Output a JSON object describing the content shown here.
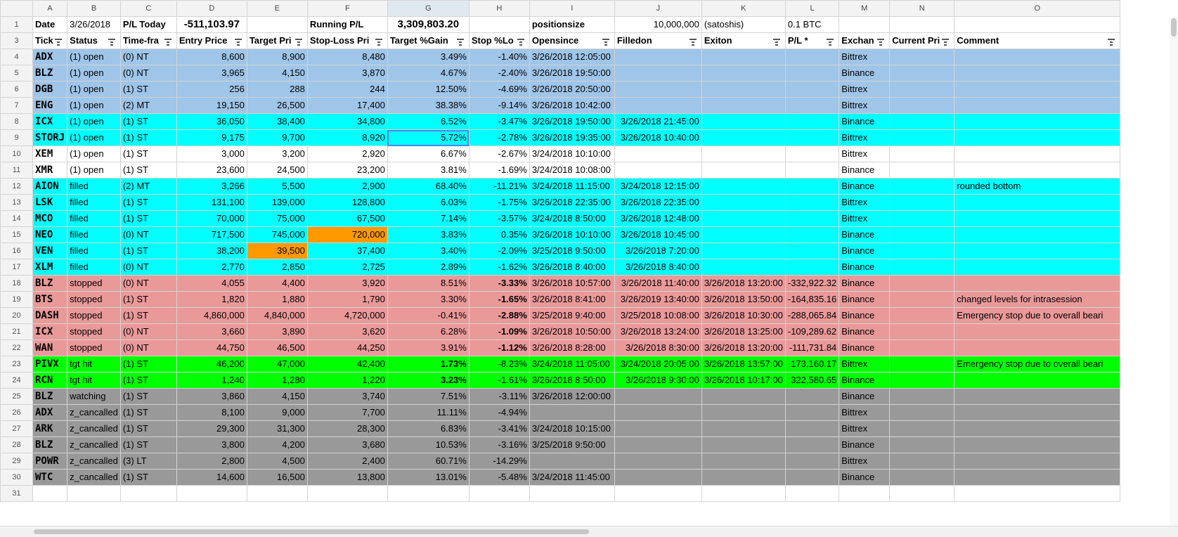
{
  "columns": [
    "A",
    "B",
    "C",
    "D",
    "E",
    "F",
    "G",
    "H",
    "I",
    "J",
    "K",
    "L",
    "M",
    "N",
    "O"
  ],
  "top_row": {
    "row_num": "1",
    "cells": [
      "Date",
      "3/26/2018",
      "P/L Today",
      "-511,103.97",
      "",
      "Running P/L",
      "3,309,803.20",
      "",
      "positionsize",
      "10,000,000",
      "(satoshis)",
      "0.1 BTC",
      "",
      "",
      ""
    ]
  },
  "header_row": {
    "row_num": "3",
    "cells": [
      "Tick",
      "Status",
      "Time-fra",
      "Entry Price",
      "Target Pri",
      "Stop-Loss Pri",
      "Target %Gain",
      "Stop %Lo",
      "Opensince",
      "Filledon",
      "Exiton",
      "P/L *",
      "Exchan",
      "Current Pri",
      "Comment"
    ]
  },
  "rows": [
    {
      "n": "4",
      "style": "blue",
      "c": [
        "ADX",
        "(1) open",
        "(0) NT",
        "8,600",
        "8,900",
        "8,480",
        "3.49%",
        "-1.40%",
        "3/26/2018 12:05:00",
        "",
        "",
        "",
        "Bittrex",
        "",
        ""
      ]
    },
    {
      "n": "5",
      "style": "blue",
      "c": [
        "BLZ",
        "(1) open",
        "(0) NT",
        "3,965",
        "4,150",
        "3,870",
        "4.67%",
        "-2.40%",
        "3/26/2018 19:50:00",
        "",
        "",
        "",
        "Binance",
        "",
        ""
      ]
    },
    {
      "n": "6",
      "style": "blue",
      "c": [
        "DGB",
        "(1) open",
        "(1) ST",
        "256",
        "288",
        "244",
        "12.50%",
        "-4.69%",
        "3/26/2018 20:50:00",
        "",
        "",
        "",
        "Bittrex",
        "",
        ""
      ]
    },
    {
      "n": "7",
      "style": "blue",
      "c": [
        "ENG",
        "(1) open",
        "(2) MT",
        "19,150",
        "26,500",
        "17,400",
        "38.38%",
        "-9.14%",
        "3/26/2018 10:42:00",
        "",
        "",
        "",
        "Bittrex",
        "",
        ""
      ]
    },
    {
      "n": "8",
      "style": "cyan",
      "c": [
        "ICX",
        "(1) open",
        "(1) ST",
        "36,050",
        "38,400",
        "34,800",
        "6.52%",
        "-3.47%",
        "3/26/2018 19:50:00",
        "3/26/2018 21:45:00",
        "",
        "",
        "Binance",
        "",
        ""
      ]
    },
    {
      "n": "9",
      "style": "cyan",
      "c": [
        "STORJ",
        "(1) open",
        "(1) ST",
        "9,175",
        "9,700",
        "8,920",
        "5.72%",
        "-2.78%",
        "3/26/2018 19:35:00",
        "3/26/2018 10:40:00",
        "",
        "",
        "Bittrex",
        "",
        ""
      ]
    },
    {
      "n": "10",
      "style": "white",
      "c": [
        "XEM",
        "(1) open",
        "(1) ST",
        "3,000",
        "3,200",
        "2,920",
        "6.67%",
        "-2.67%",
        "3/24/2018 10:10:00",
        "",
        "",
        "",
        "Bittrex",
        "",
        ""
      ]
    },
    {
      "n": "11",
      "style": "white",
      "c": [
        "XMR",
        "(1) open",
        "(1) ST",
        "23,600",
        "24,500",
        "23,200",
        "3.81%",
        "-1.69%",
        "3/24/2018 10:08:00",
        "",
        "",
        "",
        "Binance",
        "",
        ""
      ]
    },
    {
      "n": "12",
      "style": "cyan",
      "c": [
        "AION",
        "filled",
        "(2) MT",
        "3,266",
        "5,500",
        "2,900",
        "68.40%",
        "-11.21%",
        "3/24/2018 11:15:00",
        "3/24/2018 12:15:00",
        "",
        "",
        "Binance",
        "",
        "rounded bottom"
      ]
    },
    {
      "n": "13",
      "style": "cyan",
      "c": [
        "LSK",
        "filled",
        "(1) ST",
        "131,100",
        "139,000",
        "128,800",
        "6.03%",
        "-1.75%",
        "3/26/2018 22:35:00",
        "3/26/2018 22:35:00",
        "",
        "",
        "Bittrex",
        "",
        ""
      ]
    },
    {
      "n": "14",
      "style": "cyan",
      "c": [
        "MCO",
        "filled",
        "(1) ST",
        "70,000",
        "75,000",
        "67,500",
        "7.14%",
        "-3.57%",
        "3/24/2018 8:50:00",
        "3/26/2018 12:48:00",
        "",
        "",
        "Bittrex",
        "",
        ""
      ]
    },
    {
      "n": "15",
      "style": "cyan",
      "c": [
        "NEO",
        "filled",
        "(0) NT",
        "717,500",
        "745,000",
        "720,000",
        "3.83%",
        "0.35%",
        "3/26/2018 10:10:00",
        "3/26/2018 10:45:00",
        "",
        "",
        "Binance",
        "",
        ""
      ]
    },
    {
      "n": "16",
      "style": "cyan",
      "c": [
        "VEN",
        "filled",
        "(1) ST",
        "38,200",
        "39,500",
        "37,400",
        "3.40%",
        "-2.09%",
        "3/25/2018 9:50:00",
        "3/26/2018 7:20:00",
        "",
        "",
        "Binance",
        "",
        ""
      ]
    },
    {
      "n": "17",
      "style": "cyan",
      "c": [
        "XLM",
        "filled",
        "(0) NT",
        "2,770",
        "2,850",
        "2,725",
        "2.89%",
        "-1.62%",
        "3/26/2018 8:40:00",
        "3/26/2018 8:40:00",
        "",
        "",
        "Binance",
        "",
        ""
      ]
    },
    {
      "n": "18",
      "style": "red",
      "c": [
        "BLZ",
        "stopped",
        "(0) NT",
        "4,055",
        "4,400",
        "3,920",
        "8.51%",
        "-3.33%",
        "3/26/2018 10:57:00",
        "3/26/2018 11:40:00",
        "3/26/2018 13:20:00",
        "-332,922.32",
        "Binance",
        "",
        ""
      ]
    },
    {
      "n": "19",
      "style": "red",
      "c": [
        "BTS",
        "stopped",
        "(1) ST",
        "1,820",
        "1,880",
        "1,790",
        "3.30%",
        "-1.65%",
        "3/26/2018 8:41:00",
        "3/26/2019 13:40:00",
        "3/26/2018 13:50:00",
        "-164,835.16",
        "Binance",
        "",
        "changed levels for intrasession"
      ]
    },
    {
      "n": "20",
      "style": "red",
      "c": [
        "DASH",
        "stopped",
        "(1) ST",
        "4,860,000",
        "4,840,000",
        "4,720,000",
        "-0.41%",
        "-2.88%",
        "3/25/2018 9:40:00",
        "3/25/2018 10:08:00",
        "3/26/2018 10:30:00",
        "-288,065.84",
        "Binance",
        "",
        "Emergency stop due to overall beari"
      ]
    },
    {
      "n": "21",
      "style": "red",
      "c": [
        "ICX",
        "stopped",
        "(0) NT",
        "3,660",
        "3,890",
        "3,620",
        "6.28%",
        "-1.09%",
        "3/26/2018 10:50:00",
        "3/26/2018 13:24:00",
        "3/26/2018 13:25:00",
        "-109,289.62",
        "Binance",
        "",
        ""
      ]
    },
    {
      "n": "22",
      "style": "red",
      "c": [
        "WAN",
        "stopped",
        "(0) NT",
        "44,750",
        "46,500",
        "44,250",
        "3.91%",
        "-1.12%",
        "3/26/2018 8:28:00",
        "3/26/2018 8:30:00",
        "3/26/2018 13:20:00",
        "-111,731.84",
        "Binance",
        "",
        ""
      ]
    },
    {
      "n": "23",
      "style": "green",
      "c": [
        "PIVX",
        "tgt hit",
        "(1) ST",
        "46,200",
        "47,000",
        "42,400",
        "1.73%",
        "-8.23%",
        "3/24/2018 11:05:00",
        "3/24/2018 20:05:00",
        "3/26/2018 13:57:00",
        "173,160.17",
        "Bittrex",
        "",
        "Emergency stop due to overall beari"
      ]
    },
    {
      "n": "24",
      "style": "green",
      "c": [
        "RCN",
        "tgt hit",
        "(1) ST",
        "1,240",
        "1,280",
        "1,220",
        "3.23%",
        "-1.61%",
        "3/26/2018 8:50:00",
        "3/26/2018 9:30:00",
        "3/26/2018 10:17:00",
        "322,580.65",
        "Binance",
        "",
        ""
      ]
    },
    {
      "n": "25",
      "style": "gray",
      "c": [
        "BLZ",
        "watching",
        "(1) ST",
        "3,860",
        "4,150",
        "3,740",
        "7.51%",
        "-3.11%",
        "3/26/2018 12:00:00",
        "",
        "",
        "",
        "Binance",
        "",
        ""
      ]
    },
    {
      "n": "26",
      "style": "gray",
      "c": [
        "ADX",
        "z_cancalled",
        "(1) ST",
        "8,100",
        "9,000",
        "7,700",
        "11.11%",
        "-4.94%",
        "",
        "",
        "",
        "",
        "Bittrex",
        "",
        ""
      ]
    },
    {
      "n": "27",
      "style": "gray",
      "c": [
        "ARK",
        "z_cancalled",
        "(1) ST",
        "29,300",
        "31,300",
        "28,300",
        "6.83%",
        "-3.41%",
        "3/24/2018 10:15:00",
        "",
        "",
        "",
        "Bittrex",
        "",
        ""
      ]
    },
    {
      "n": "28",
      "style": "gray",
      "c": [
        "BLZ",
        "z_cancalled",
        "(1) ST",
        "3,800",
        "4,200",
        "3,680",
        "10.53%",
        "-3.16%",
        "3/25/2018 9:50:00",
        "",
        "",
        "",
        "Binance",
        "",
        ""
      ]
    },
    {
      "n": "29",
      "style": "gray",
      "c": [
        "POWR",
        "z_cancalled",
        "(3) LT",
        "2,800",
        "4,500",
        "2,400",
        "60.71%",
        "-14.29%",
        "",
        "",
        "",
        "",
        "Bittrex",
        "",
        ""
      ]
    },
    {
      "n": "30",
      "style": "gray",
      "c": [
        "WTC",
        "z_cancalled",
        "(1) ST",
        "14,600",
        "16,500",
        "13,800",
        "13.01%",
        "-5.48%",
        "3/24/2018 11:45:00",
        "",
        "",
        "",
        "Binance",
        "",
        ""
      ]
    },
    {
      "n": "31",
      "style": "empty",
      "c": [
        "",
        "",
        "",
        "",
        "",
        "",
        "",
        "",
        "",
        "",
        "",
        "",
        "",
        "",
        ""
      ]
    }
  ],
  "colors": {
    "open_blue": "#9fc5e8",
    "cyan": "#00ffff",
    "stopped_red": "#ea9999",
    "target_green": "#00ff00",
    "cancelled_gray": "#999999",
    "highlight_orange": "#ff9900"
  }
}
